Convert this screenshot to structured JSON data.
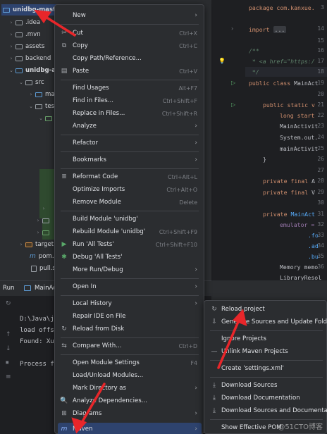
{
  "tree": {
    "root": "unidbg-mast",
    "rows": [
      {
        "label": ".idea",
        "chev": "›",
        "icon": "folder"
      },
      {
        "label": ".mvn",
        "chev": "›",
        "icon": "folder"
      },
      {
        "label": "assets",
        "chev": "›",
        "icon": "folder"
      },
      {
        "label": "backend",
        "chev": "›",
        "icon": "folder"
      },
      {
        "label": "unidbg-a",
        "chev": "⌄",
        "icon": "module"
      },
      {
        "label": "src",
        "chev": "⌄",
        "icon": "folder"
      },
      {
        "label": "ma",
        "chev": "›",
        "icon": "folder"
      },
      {
        "label": "tes",
        "chev": "⌄",
        "icon": "folder"
      },
      {
        "label": "",
        "chev": "⌄",
        "icon": "test"
      },
      {
        "label": "target",
        "chev": "›",
        "icon": "orange"
      },
      {
        "label": "pom.x",
        "chev": "",
        "icon": "maven"
      },
      {
        "label": "pull.sh",
        "chev": "",
        "icon": "file"
      }
    ]
  },
  "editor": {
    "line_numbers": [
      "3",
      "14",
      "15",
      "16",
      "17",
      "18",
      "19",
      "20",
      "21",
      "22",
      "23",
      "24",
      "25",
      "26",
      "27",
      "28",
      "29",
      "30",
      "31",
      "32",
      "33",
      "34",
      "35",
      "36",
      "37",
      "38"
    ],
    "code": {
      "l3": "package com.kanxue.",
      "l14_kw": "import",
      "l14_fold": "...",
      "l17": "/**",
      "l18": " * <a href=\"https:/",
      "l19": " */",
      "l20_kw": "public class",
      "l20_name": " MainAct",
      "l22_kw": "public static v",
      "l23": "long start",
      "l24": "MainActivit",
      "l25": "System.out.",
      "l26": "mainActivit",
      "l27": "}",
      "l29_kw": "private final",
      "l29_rest": " A",
      "l30_kw": "private final",
      "l30_rest": " V",
      "l32_kw": "private",
      "l32_rest": " MainAct",
      "l33": "emulator = ",
      "l34": ".fo",
      "l35": ".ad",
      "l36": ".bu",
      "l37": "Memory memo",
      "l38": "LibraryResol"
    }
  },
  "runbar": {
    "tab": "Run",
    "config": "MainAc"
  },
  "console": {
    "lines": [
      "D:\\Java\\je",
      "load offse",
      "Found: Xu",
      "",
      "Process f"
    ],
    "side_icons": [
      "↻",
      "↑",
      "↓",
      "⏹",
      "≡"
    ]
  },
  "context_menu": {
    "items": [
      {
        "icon": "",
        "label": "New",
        "shortcut": "",
        "submenu": true
      },
      {
        "icon": "✂",
        "label": "Cut",
        "shortcut": "Ctrl+X",
        "submenu": false
      },
      {
        "icon": "⧉",
        "label": "Copy",
        "shortcut": "Ctrl+C",
        "submenu": false
      },
      {
        "icon": "",
        "label": "Copy Path/Reference...",
        "shortcut": "",
        "submenu": false
      },
      {
        "icon": "▤",
        "label": "Paste",
        "shortcut": "Ctrl+V",
        "submenu": false
      },
      {
        "icon": "",
        "label": "Find Usages",
        "shortcut": "Alt+F7",
        "submenu": false
      },
      {
        "icon": "",
        "label": "Find in Files...",
        "shortcut": "Ctrl+Shift+F",
        "submenu": false
      },
      {
        "icon": "",
        "label": "Replace in Files...",
        "shortcut": "Ctrl+Shift+R",
        "submenu": false
      },
      {
        "icon": "",
        "label": "Analyze",
        "shortcut": "",
        "submenu": true
      },
      {
        "icon": "",
        "label": "Refactor",
        "shortcut": "",
        "submenu": true
      },
      {
        "icon": "",
        "label": "Bookmarks",
        "shortcut": "",
        "submenu": true
      },
      {
        "icon": "≣",
        "label": "Reformat Code",
        "shortcut": "Ctrl+Alt+L",
        "submenu": false
      },
      {
        "icon": "",
        "label": "Optimize Imports",
        "shortcut": "Ctrl+Alt+O",
        "submenu": false
      },
      {
        "icon": "",
        "label": "Remove Module",
        "shortcut": "Delete",
        "submenu": false
      },
      {
        "icon": "",
        "label": "Build Module 'unidbg'",
        "shortcut": "",
        "submenu": false
      },
      {
        "icon": "",
        "label": "Rebuild Module 'unidbg'",
        "shortcut": "Ctrl+Shift+F9",
        "submenu": false
      },
      {
        "icon": "▶",
        "label": "Run 'All Tests'",
        "shortcut": "Ctrl+Shift+F10",
        "submenu": false
      },
      {
        "icon": "✱",
        "label": "Debug 'All Tests'",
        "shortcut": "",
        "submenu": false
      },
      {
        "icon": "",
        "label": "More Run/Debug",
        "shortcut": "",
        "submenu": true
      },
      {
        "icon": "",
        "label": "Open In",
        "shortcut": "",
        "submenu": true
      },
      {
        "icon": "",
        "label": "Local History",
        "shortcut": "",
        "submenu": true
      },
      {
        "icon": "",
        "label": "Repair IDE on File",
        "shortcut": "",
        "submenu": false
      },
      {
        "icon": "↻",
        "label": "Reload from Disk",
        "shortcut": "",
        "submenu": false
      },
      {
        "icon": "⇆",
        "label": "Compare With...",
        "shortcut": "Ctrl+D",
        "submenu": false
      },
      {
        "icon": "",
        "label": "Open Module Settings",
        "shortcut": "F4",
        "submenu": false
      },
      {
        "icon": "",
        "label": "Load/Unload Modules...",
        "shortcut": "",
        "submenu": false
      },
      {
        "icon": "",
        "label": "Mark Directory as",
        "shortcut": "",
        "submenu": true
      },
      {
        "icon": "🔍",
        "label": "Analyze Dependencies...",
        "shortcut": "",
        "submenu": false
      },
      {
        "icon": "⊞",
        "label": "Diagrams",
        "shortcut": "",
        "submenu": true
      },
      {
        "icon": "m",
        "label": "Maven",
        "shortcut": "",
        "submenu": true
      }
    ]
  },
  "maven_submenu": {
    "items": [
      {
        "icon": "↻",
        "label": "Reload project"
      },
      {
        "icon": "⇩",
        "label": "Generate Sources and Update Folde"
      },
      {
        "icon": "",
        "label": "Ignore Projects"
      },
      {
        "icon": "—",
        "label": "Unlink Maven Projects"
      },
      {
        "icon": "",
        "label": "Create 'settings.xml'"
      },
      {
        "icon": "⤓",
        "label": "Download Sources"
      },
      {
        "icon": "⤓",
        "label": "Download Documentation"
      },
      {
        "icon": "⤓",
        "label": "Download Sources and Documentati"
      },
      {
        "icon": "",
        "label": "Show Effective POM"
      }
    ]
  },
  "watermark": "@51CTO博客",
  "colors": {
    "accent_selected": "#2e436e",
    "arrow_red": "#e8262a",
    "test_green": "#59a869"
  }
}
